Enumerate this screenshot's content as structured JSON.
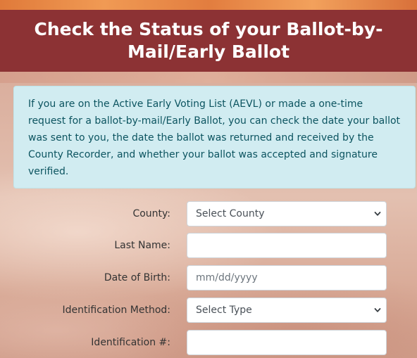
{
  "header": {
    "title": "Check the Status of your Ballot-by-Mail/Early Ballot"
  },
  "info": {
    "text": "If you are on the Active Early Voting List (AEVL) or made a one-time request for a ballot-by-mail/Early Ballot, you can check the date your ballot was sent to you, the date the ballot was returned and received by the County Recorder, and whether your ballot was accepted and signature verified."
  },
  "form": {
    "county": {
      "label": "County:",
      "selected": "Select County"
    },
    "last_name": {
      "label": "Last Name:",
      "value": ""
    },
    "dob": {
      "label": "Date of Birth:",
      "placeholder": "mm/dd/yyyy"
    },
    "id_method": {
      "label": "Identification Method:",
      "selected": "Select Type"
    },
    "id_number": {
      "label": "Identification #:",
      "value": ""
    }
  },
  "colors": {
    "header_bg": "#8c3234",
    "info_bg": "#d1ecf1",
    "info_text": "#0c5460"
  }
}
